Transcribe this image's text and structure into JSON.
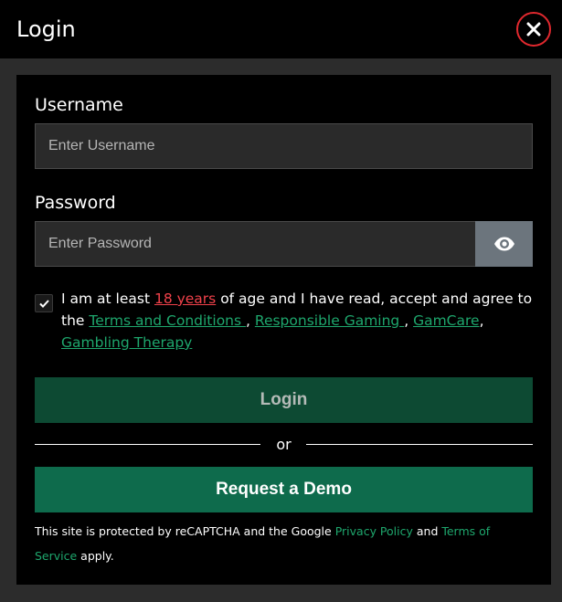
{
  "header": {
    "title": "Login"
  },
  "form": {
    "username": {
      "label": "Username",
      "placeholder": "Enter Username",
      "value": ""
    },
    "password": {
      "label": "Password",
      "placeholder": "Enter Password",
      "value": ""
    },
    "agreement": {
      "checked": true,
      "text_1": "I am at least ",
      "age_link": "18 years",
      "text_2": " of age and I have read, accept and agree to the ",
      "terms_link": "Terms and Conditions ",
      "sep_1": ", ",
      "responsible_link": "Responsible Gaming ",
      "sep_2": ", ",
      "gamcare_link": "GamCare",
      "sep_3": ", ",
      "therapy_link": "Gambling Therapy"
    },
    "login_label": "Login",
    "or_label": "or",
    "demo_label": "Request a Demo"
  },
  "recaptcha": {
    "text_1": "This site is protected by reCAPTCHA and the Google ",
    "privacy_link": "Privacy Policy",
    "text_2": " and ",
    "terms_link": "Terms of Service",
    "text_3": " apply."
  },
  "colors": {
    "accent_green": "#1ea76d",
    "accent_red": "#f0414a",
    "login_button": "#0d4a33",
    "demo_button": "#0e6b4c"
  },
  "icons": {
    "close": "close-icon",
    "eye": "eye-icon",
    "check": "check-icon"
  }
}
